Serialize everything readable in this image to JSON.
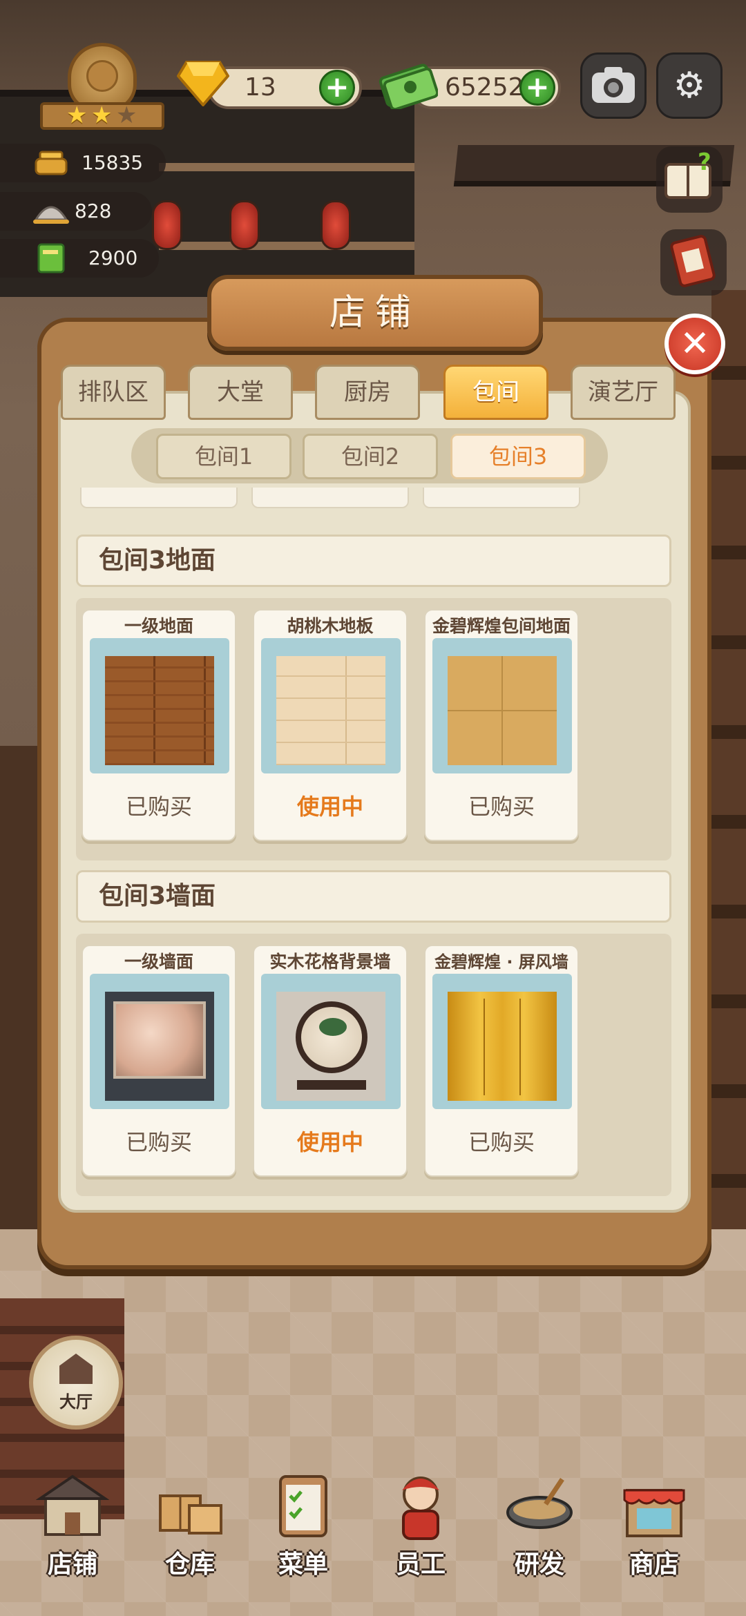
{
  "hud": {
    "gems": "13",
    "cash": "65252",
    "stats": [
      "15835",
      "828",
      "2900"
    ],
    "stars_filled": 2,
    "stars_total": 3
  },
  "panel": {
    "title": "店铺",
    "tabs": [
      "排队区",
      "大堂",
      "厨房",
      "包间",
      "演艺厅"
    ],
    "active_tab": "包间",
    "subtabs": [
      "包间1",
      "包间2",
      "包间3"
    ],
    "active_subtab": "包间3",
    "sections": [
      {
        "title": "包间3地面",
        "items": [
          {
            "name": "一级地面",
            "status": "已购买"
          },
          {
            "name": "胡桃木地板",
            "status": "使用中"
          },
          {
            "name": "金碧辉煌包间地面",
            "status": "已购买"
          }
        ]
      },
      {
        "title": "包间3墙面",
        "items": [
          {
            "name": "一级墙面",
            "status": "已购买"
          },
          {
            "name": "实木花格背景墙",
            "status": "使用中"
          },
          {
            "name": "金碧辉煌 · 屏风墙",
            "status": "已购买"
          }
        ]
      }
    ]
  },
  "hall_button": "大厅",
  "bottom_nav": [
    "店铺",
    "仓库",
    "菜单",
    "员工",
    "研发",
    "商店"
  ],
  "colors": {
    "accent_orange": "#e57a1c",
    "tab_active": "#f4b13a",
    "plus_green": "#2f8a23",
    "close_red": "#c53322"
  },
  "icons": {
    "gem": "gem-icon",
    "cash": "cash-icon",
    "camera": "camera-icon",
    "settings": "gear-icon",
    "close": "close-icon"
  }
}
